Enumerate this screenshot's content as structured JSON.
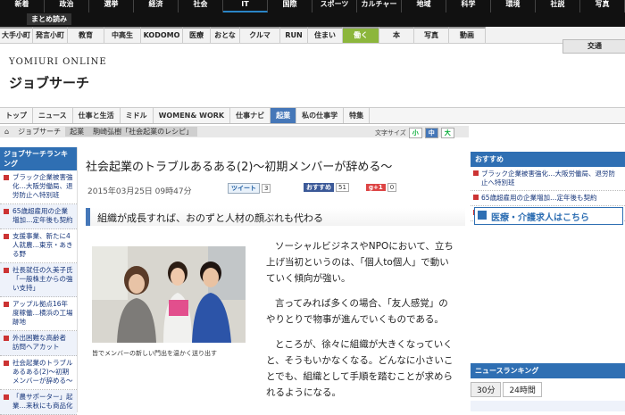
{
  "topnav": {
    "items": [
      "新着",
      "政治",
      "選挙",
      "経済",
      "社会",
      "IT",
      "国際",
      "スポーツ",
      "カルチャー",
      "地域",
      "科学",
      "環境",
      "社説",
      "写真"
    ],
    "matome": "まとめ読み"
  },
  "subnav": {
    "items": [
      "大手小町",
      "発言小町",
      "教育",
      "中高生",
      "KODOMO",
      "医療",
      "おとな",
      "クルマ",
      "RUN",
      "住まい",
      "働く",
      "本",
      "写真",
      "動画"
    ],
    "active": "働く",
    "kotsu": "交通"
  },
  "logo": {
    "site": "YOMIURI ONLINE",
    "section": "ジョブサーチ"
  },
  "tabs": {
    "items": [
      "トップ",
      "ニュース",
      "仕事と生活",
      "ミドル",
      "WOMEN& WORK",
      "仕事ナビ",
      "起業",
      "私の仕事学",
      "特集"
    ],
    "active": "起業"
  },
  "breadcrumb": {
    "items": [
      "ジョブサーチ",
      "起業",
      "駒崎弘樹「社会起業のレシピ」"
    ]
  },
  "fontsize": {
    "label": "文字サイズ",
    "small": "小",
    "medium": "中",
    "large": "大"
  },
  "left_sidebar": {
    "head": "ジョブサーチランキング",
    "items": [
      "ブラック企業被害強化…大阪労働局、退労防止へ特別班",
      "65歳超雇用の企業増加…定年後も契約",
      "支援事業、新たに4人就農…東京・あきる野",
      "社長就任の久美子氏「一般株主からの強い支持」",
      "アップル拠点16年度稼働…横浜の工場跡地",
      "外出困難な高齢者 訪問ヘアカット",
      "社会起業のトラブルあるある(2)〜初期メンバーが辞める〜",
      "「農サポーター」起業…来秋にも商品化"
    ]
  },
  "article": {
    "title": "社会起業のトラブルあるある(2)〜初期メンバーが辞める〜",
    "date": "2015年03月25日 09時47分",
    "tweet_label": "ツイート",
    "tweet_count": "3",
    "fb_label": "おすすめ",
    "fb_count": "51",
    "gp_label": "g+1",
    "gp_count": "0",
    "subhead": "組織が成長すれば、おのずと人材の顔ぶれも代わる",
    "caption": "皆でメンバーの新しい門出を温かく送り出す",
    "paragraphs": [
      "ソーシャルビジネスやNPOにおいて、立ち上げ当初というのは、「個人to個人」で動いていく傾向が強い。",
      "言ってみれば多くの場合、「友人感覚」のやりとりで物事が進んでいくものである。",
      "ところが、徐々に組織が大きくなっていくと、そうもいかなくなる。どんなに小さいことでも、組織として手順を踏むことが求められるようになる。"
    ]
  },
  "right_sidebar": {
    "head": "おすすめ",
    "items": [
      "ブラック企業被害強化…大阪労働局、退労防止へ特別班",
      "65歳超雇用の企業増加…定年後も契約",
      "支援事業、新たに4人就農…東京・あきる野"
    ],
    "banner": "医療・介護求人はこちら",
    "ranking_head": "ニュースランキング",
    "ranking_tabs": [
      "30分",
      "24時間"
    ]
  },
  "colors": {
    "accent": "#2f6fb3",
    "work_green": "#8cb63c",
    "badge_red": "#cc3333"
  }
}
